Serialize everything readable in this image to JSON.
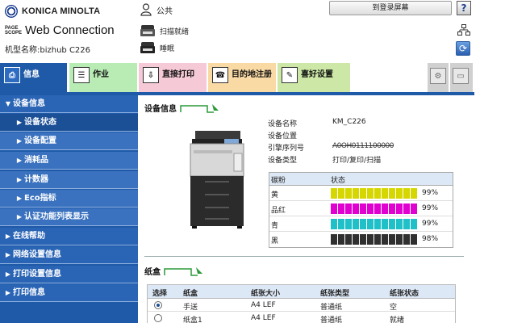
{
  "header": {
    "brand": "KONICA MINOLTA",
    "pagescope_line1": "PAGE",
    "pagescope_line2": "SCOPE",
    "app_title": "Web Connection",
    "model_label": "机型名称:bizhub C226",
    "user_name": "公共",
    "login_button": "到登录屏幕",
    "help_label": "?",
    "scan_status": "扫描就绪",
    "print_status": "睡眠"
  },
  "tabs": [
    {
      "label": "信息",
      "icon": "info-icon"
    },
    {
      "label": "作业",
      "icon": "job-icon"
    },
    {
      "label": "直接打印",
      "icon": "direct-print-icon"
    },
    {
      "label": "目的地注册",
      "icon": "destination-icon"
    },
    {
      "label": "喜好设置",
      "icon": "favorites-icon"
    }
  ],
  "sidebar": {
    "items": [
      {
        "label": "设备信息",
        "level": "top",
        "arrow": "▼"
      },
      {
        "label": "设备状态",
        "level": "sub",
        "arrow": "▶"
      },
      {
        "label": "设备配置",
        "level": "sub",
        "arrow": "▶"
      },
      {
        "label": "消耗品",
        "level": "sub",
        "arrow": "▶"
      },
      {
        "label": "计数器",
        "level": "sub",
        "arrow": "▶"
      },
      {
        "label": "Eco指标",
        "level": "sub",
        "arrow": "▶"
      },
      {
        "label": "认证功能列表显示",
        "level": "sub",
        "arrow": "▶"
      },
      {
        "label": "在线帮助",
        "level": "top",
        "arrow": "▶"
      },
      {
        "label": "网络设置信息",
        "level": "top",
        "arrow": "▶"
      },
      {
        "label": "打印设置信息",
        "level": "top",
        "arrow": "▶"
      },
      {
        "label": "打印信息",
        "level": "top",
        "arrow": "▶"
      }
    ]
  },
  "device_info": {
    "section_title": "设备信息",
    "rows": [
      {
        "label": "设备名称",
        "value": "KM_C226"
      },
      {
        "label": "设备位置",
        "value": ""
      },
      {
        "label": "引擎序列号",
        "value": "A0OH0111100000"
      },
      {
        "label": "设备类型",
        "value": "打印/复印/扫描"
      }
    ]
  },
  "toner": {
    "header_color": "碳粉",
    "header_status": "状态",
    "rows": [
      {
        "name": "黄",
        "level": 99,
        "color": "#d6d600",
        "percent": "99%"
      },
      {
        "name": "品红",
        "level": 99,
        "color": "#e000d0",
        "percent": "99%"
      },
      {
        "name": "青",
        "level": 99,
        "color": "#20c0c8",
        "percent": "99%"
      },
      {
        "name": "黑",
        "level": 98,
        "color": "#303030",
        "percent": "98%"
      }
    ]
  },
  "paper_tray": {
    "section_title": "纸盒",
    "headers": [
      "选择",
      "纸盒",
      "纸张大小",
      "纸张类型",
      "纸张状态"
    ],
    "rows": [
      {
        "selected": true,
        "tray": "手送",
        "size": "A4 LEF",
        "type": "普通纸",
        "status": "空"
      },
      {
        "selected": false,
        "tray": "纸盒1",
        "size": "A4 LEF",
        "type": "普通纸",
        "status": "就绪"
      }
    ]
  }
}
